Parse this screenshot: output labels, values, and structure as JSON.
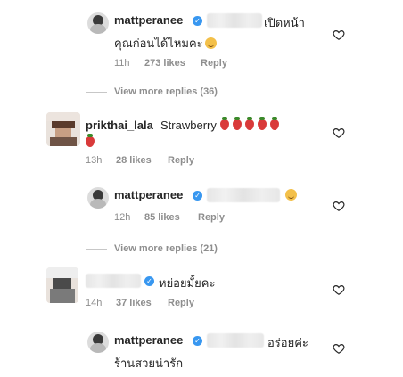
{
  "comments": [
    {
      "username": "mattperanee",
      "text_after": "เปิดหน้า",
      "text_line2": "คุณก่อนได้ไหมคะ",
      "time": "11h",
      "likes": "273 likes",
      "reply": "Reply"
    },
    {
      "username": "prikthai_lala",
      "text": "Strawberry",
      "time": "13h",
      "likes": "28 likes",
      "reply": "Reply"
    },
    {
      "username": "mattperanee",
      "time": "12h",
      "likes": "85 likes",
      "reply": "Reply"
    },
    {
      "text": "หย่อยมั้ยคะ",
      "time": "14h",
      "likes": "37 likes",
      "reply": "Reply"
    },
    {
      "username": "mattperanee",
      "text_after": "อร่อยค่ะ",
      "text_line2": "ร้านสวยน่ารัก"
    }
  ],
  "view_more": [
    "View more replies (36)",
    "View more replies (21)"
  ],
  "colors": {
    "verified": "#3897f0",
    "meta": "#8e8e8e",
    "text": "#262626"
  },
  "icons": {
    "verified": "verified-badge-icon",
    "like": "heart-outline-icon"
  }
}
